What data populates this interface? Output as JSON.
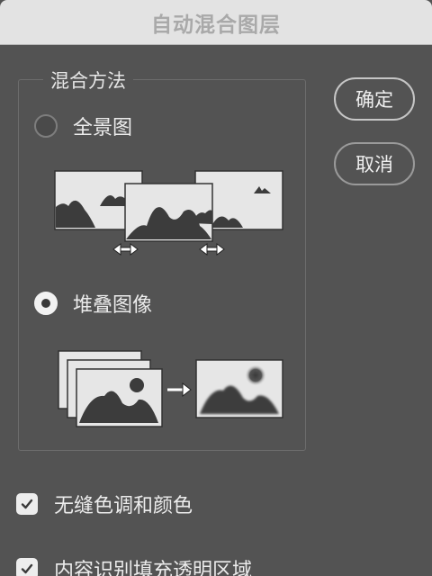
{
  "window": {
    "title": "自动混合图层"
  },
  "blend_method": {
    "legend": "混合方法",
    "options": [
      {
        "label": "全景图",
        "selected": false,
        "icon": "panorama-illustration"
      },
      {
        "label": "堆叠图像",
        "selected": true,
        "icon": "stack-images-illustration"
      }
    ]
  },
  "buttons": {
    "ok": "确定",
    "cancel": "取消"
  },
  "checkboxes": [
    {
      "label": "无缝色调和颜色",
      "checked": true
    },
    {
      "label": "内容识别填充透明区域",
      "checked": true
    }
  ],
  "colors": {
    "dialog_bg": "#535353",
    "titlebar_bg": "#e3e3e3",
    "title_text": "#a9a9a9",
    "text": "#ececec",
    "illustration_fill": "#e6e6e6",
    "illustration_dark": "#3c3c3c"
  }
}
